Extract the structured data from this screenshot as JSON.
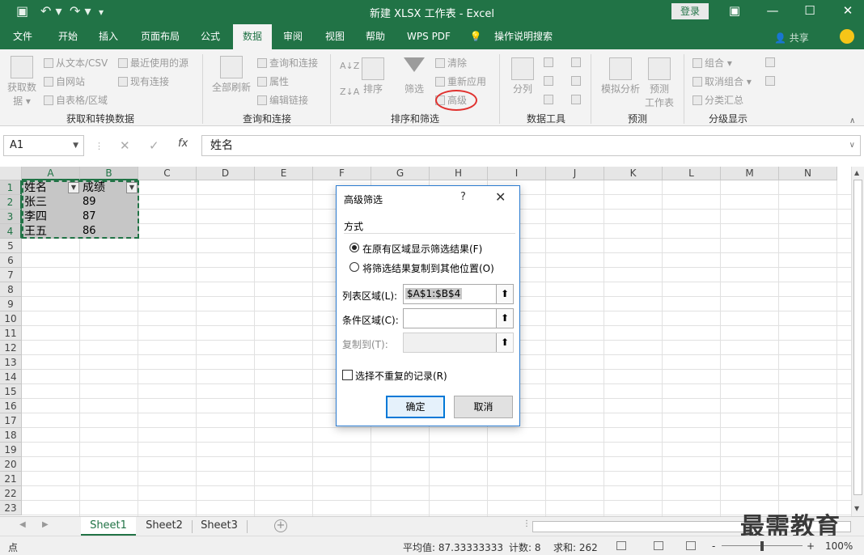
{
  "titlebar": {
    "title": "新建 XLSX 工作表  -  Excel",
    "login": "登录",
    "qa_save": "▣",
    "qa_undo": "↶ ▾",
    "qa_redo": "↷ ▾",
    "qa_more": "▾",
    "ctl_ribbon": "▣",
    "ctl_min": "—",
    "ctl_max": "☐",
    "ctl_close": "✕"
  },
  "menu": {
    "tabs": [
      "文件",
      "开始",
      "插入",
      "页面布局",
      "公式",
      "数据",
      "审阅",
      "视图",
      "帮助",
      "WPS PDF",
      "操作说明搜索"
    ],
    "active": "数据",
    "share": "共享",
    "tell_icon": "lightbulb-icon"
  },
  "ribbon": {
    "get_data": "获取数\n据 ▾",
    "from_text": "从文本/CSV",
    "from_web": "自网站",
    "from_table": "自表格/区域",
    "recent_sources": "最近使用的源",
    "existing_conn": "现有连接",
    "group1": "获取和转换数据",
    "refresh_all": "全部刷新",
    "queries_conn": "查询和连接",
    "properties": "属性",
    "edit_links": "编辑链接",
    "group2": "查询和连接",
    "sort_az": "A↓Z",
    "sort_za": "Z↓A",
    "sort": "排序",
    "filter": "筛选",
    "clear": "清除",
    "reapply": "重新应用",
    "advanced": "高级",
    "group3": "排序和筛选",
    "text_to_cols": "分列",
    "group4": "数据工具",
    "what_if": "模拟分析",
    "forecast_sheet": "预测\n工作表",
    "group5": "预测",
    "group_btn": "组合",
    "ungroup_btn": "取消组合",
    "subtotal": "分类汇总",
    "group6": "分级显示"
  },
  "formula_bar": {
    "name_box": "A1",
    "cancel": "✕",
    "enter": "✓",
    "fx": "fx",
    "content": "姓名"
  },
  "grid": {
    "columns": [
      "A",
      "B",
      "C",
      "D",
      "E",
      "F",
      "G",
      "H",
      "I",
      "J",
      "K",
      "L",
      "M",
      "N"
    ],
    "rows": [
      "1",
      "2",
      "3",
      "4",
      "5",
      "6",
      "7",
      "8",
      "9",
      "10",
      "11",
      "12",
      "13",
      "14",
      "15",
      "16",
      "17",
      "18",
      "19",
      "20",
      "21",
      "22",
      "23"
    ],
    "cells": [
      [
        "姓名",
        "成绩"
      ],
      [
        "张三",
        "89"
      ],
      [
        "李四",
        "87"
      ],
      [
        "王五",
        "86"
      ]
    ]
  },
  "sheets": {
    "tabs": [
      "Sheet1",
      "Sheet2",
      "Sheet3"
    ],
    "active": "Sheet1",
    "add": "+"
  },
  "statusbar": {
    "ready": "点",
    "average": "平均值: 87.33333333",
    "count": "计数: 8",
    "sum": "求和: 262",
    "zoom": "100%",
    "zoom_minus": "-",
    "zoom_plus": "+"
  },
  "watermark": "最需教育",
  "dialog": {
    "title": "高级筛选",
    "help": "?",
    "close": "✕",
    "section": "方式",
    "radio1": "在原有区域显示筛选结果(F)",
    "radio2": "将筛选结果复制到其他位置(O)",
    "list_label": "列表区域(L):",
    "list_value": "$A$1:$B$4",
    "criteria_label": "条件区域(C):",
    "copyto_label": "复制到(T):",
    "unique_label": "选择不重复的记录(R)",
    "ok": "确定",
    "cancel": "取消",
    "picker": "⬆"
  },
  "colors": {
    "excel_green": "#217346",
    "annotation_red": "#e0322f",
    "dialog_border": "#2b7bd0"
  }
}
